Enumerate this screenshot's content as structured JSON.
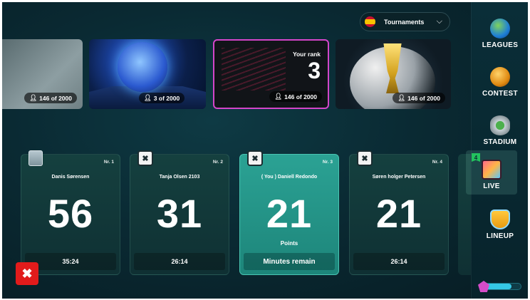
{
  "tournament_select": {
    "label": "Tournaments",
    "flag": "spain-flag-icon"
  },
  "tiles": [
    {
      "count": "146 of 2000"
    },
    {
      "count": "3 of 2000"
    },
    {
      "rank_label": "Your rank",
      "rank": "3",
      "count": "146 of 2000"
    },
    {
      "count": "146 of 2000"
    }
  ],
  "players": [
    {
      "nr": "Nr. 1",
      "name": "Danis Sørensen",
      "score": "56",
      "footer": "35:24",
      "avatar": "photo"
    },
    {
      "nr": "Nr. 2",
      "name": "Tanja Olsen 2103",
      "score": "31",
      "footer": "26:14",
      "avatar": "bot"
    },
    {
      "nr": "Nr. 3",
      "name": "( You ) Daniell Redondo",
      "score": "21",
      "points_label": "Points",
      "footer": "Minutes remain",
      "avatar": "bot"
    },
    {
      "nr": "Nr. 4",
      "name": "Søren holger Petersen",
      "score": "21",
      "footer": "26:14",
      "avatar": "bot"
    }
  ],
  "sidebar": {
    "items": [
      {
        "label": "LEAGUES",
        "icon": "globe-icon"
      },
      {
        "label": "CONTEST",
        "icon": "ball-icon"
      },
      {
        "label": "STADIUM",
        "icon": "stadium-icon"
      },
      {
        "label": "LIVE",
        "icon": "tv-icon",
        "badge": "4"
      },
      {
        "label": "LINEUP",
        "icon": "shield-icon"
      }
    ],
    "energy_fraction": 0.75
  },
  "close_label": "✖"
}
